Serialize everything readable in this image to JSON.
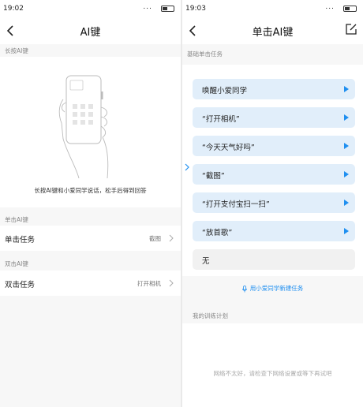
{
  "left": {
    "status": {
      "time": "19:02",
      "signal": "..."
    },
    "title": "AI键",
    "section_long_press": "长按AI键",
    "caption": "长按AI键和小爱同学说话，松手后得到回答",
    "section_single": "单击AI键",
    "single_task": {
      "label": "单击任务",
      "value": "截图"
    },
    "section_double": "双击AI键",
    "double_task": {
      "label": "双击任务",
      "value": "打开相机"
    }
  },
  "right": {
    "status": {
      "time": "19:03",
      "signal": "..."
    },
    "title": "单击AI键",
    "section_basic": "基础单击任务",
    "tasks": [
      {
        "label": "唤醒小爱同学",
        "playable": true
      },
      {
        "label": "“打开相机”",
        "playable": true
      },
      {
        "label": "“今天天气好吗”",
        "playable": true
      },
      {
        "label": "“截图”",
        "playable": true
      },
      {
        "label": "“打开支付宝扫一扫”",
        "playable": true
      },
      {
        "label": "“放首歌”",
        "playable": true
      },
      {
        "label": "无",
        "playable": false
      }
    ],
    "new_task_link": "用小爱同学新建任务",
    "section_plan": "我的训练计划",
    "network_message": "网络不太好，请检查下网络设置或等下再试吧"
  },
  "colors": {
    "accent": "#1f8ff0",
    "task_bg": "#e1eefa",
    "task_none_bg": "#f1f1f1"
  }
}
